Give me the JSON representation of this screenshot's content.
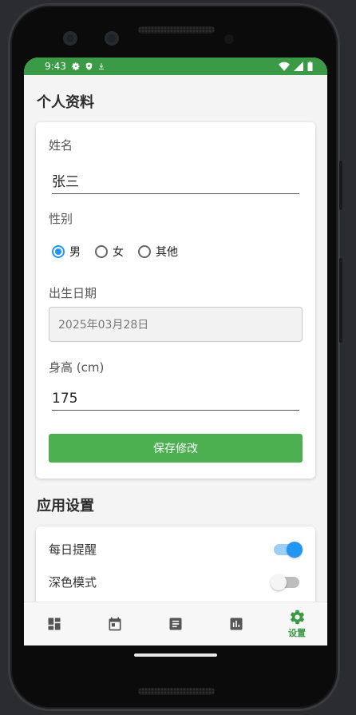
{
  "status_bar": {
    "time": "9:43",
    "left_icons": [
      "gear-icon",
      "shield-icon",
      "download-icon"
    ],
    "right_icons": [
      "wifi-icon",
      "signal-icon",
      "battery-icon"
    ],
    "color": "#3b9a45"
  },
  "profile": {
    "title": "个人资料",
    "name_label": "姓名",
    "name_value": "张三",
    "gender_label": "性别",
    "gender_options": [
      {
        "label": "男",
        "selected": true
      },
      {
        "label": "女",
        "selected": false
      },
      {
        "label": "其他",
        "selected": false
      }
    ],
    "birth_label": "出生日期",
    "birth_value": "2025年03月28日",
    "height_label": "身高 (cm)",
    "height_value": "175",
    "save_label": "保存修改",
    "save_color": "#4caf50"
  },
  "app_settings": {
    "title": "应用设置",
    "items": [
      {
        "label": "每日提醒",
        "on": true
      },
      {
        "label": "深色模式",
        "on": false
      }
    ]
  },
  "bottom_nav": {
    "items": [
      {
        "icon": "dashboard-icon",
        "label": ""
      },
      {
        "icon": "calendar-icon",
        "label": ""
      },
      {
        "icon": "notes-icon",
        "label": ""
      },
      {
        "icon": "chart-icon",
        "label": ""
      },
      {
        "icon": "settings-icon",
        "label": "设置",
        "active": true
      }
    ],
    "active_color": "#3b9a45"
  }
}
